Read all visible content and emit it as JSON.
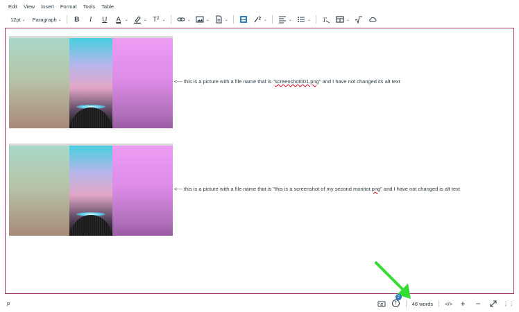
{
  "menu": {
    "items": [
      "Edit",
      "View",
      "Insert",
      "Format",
      "Tools",
      "Table"
    ]
  },
  "toolbar": {
    "font_size": "12pt",
    "block_format": "Paragraph",
    "superscript_label": "T²",
    "bold_label": "B",
    "italic_label": "I",
    "underline_label": "U",
    "text_color_label": "A"
  },
  "content": {
    "caption1_prefix": "<--- this is a picture with a file name that is \"",
    "caption1_filename": "screenshot001.png",
    "caption1_suffix": "\" and I have not changed its alt text",
    "caption2_prefix": "<--- this is a picture with a file name that is \"this is a screenshot of my second monitor.",
    "caption2_ext": "png",
    "caption2_suffix": "\" and I have not changed is alt text"
  },
  "status": {
    "path": "p",
    "a11y_issue_count": "2",
    "word_count": "48 words",
    "html_toggle": "</>",
    "icons": {
      "keyboard": "keyboard-icon",
      "accessibility": "accessibility-checker-icon",
      "zoom_in": "plus-icon",
      "zoom_out": "minus-icon",
      "fullscreen": "expand-icon",
      "resize": "resize-handle-icon"
    }
  },
  "colors": {
    "editor_border": "#a3336b",
    "badge": "#2b7abc",
    "arrow": "#33dd33",
    "spellcheck": "#d0021b"
  }
}
